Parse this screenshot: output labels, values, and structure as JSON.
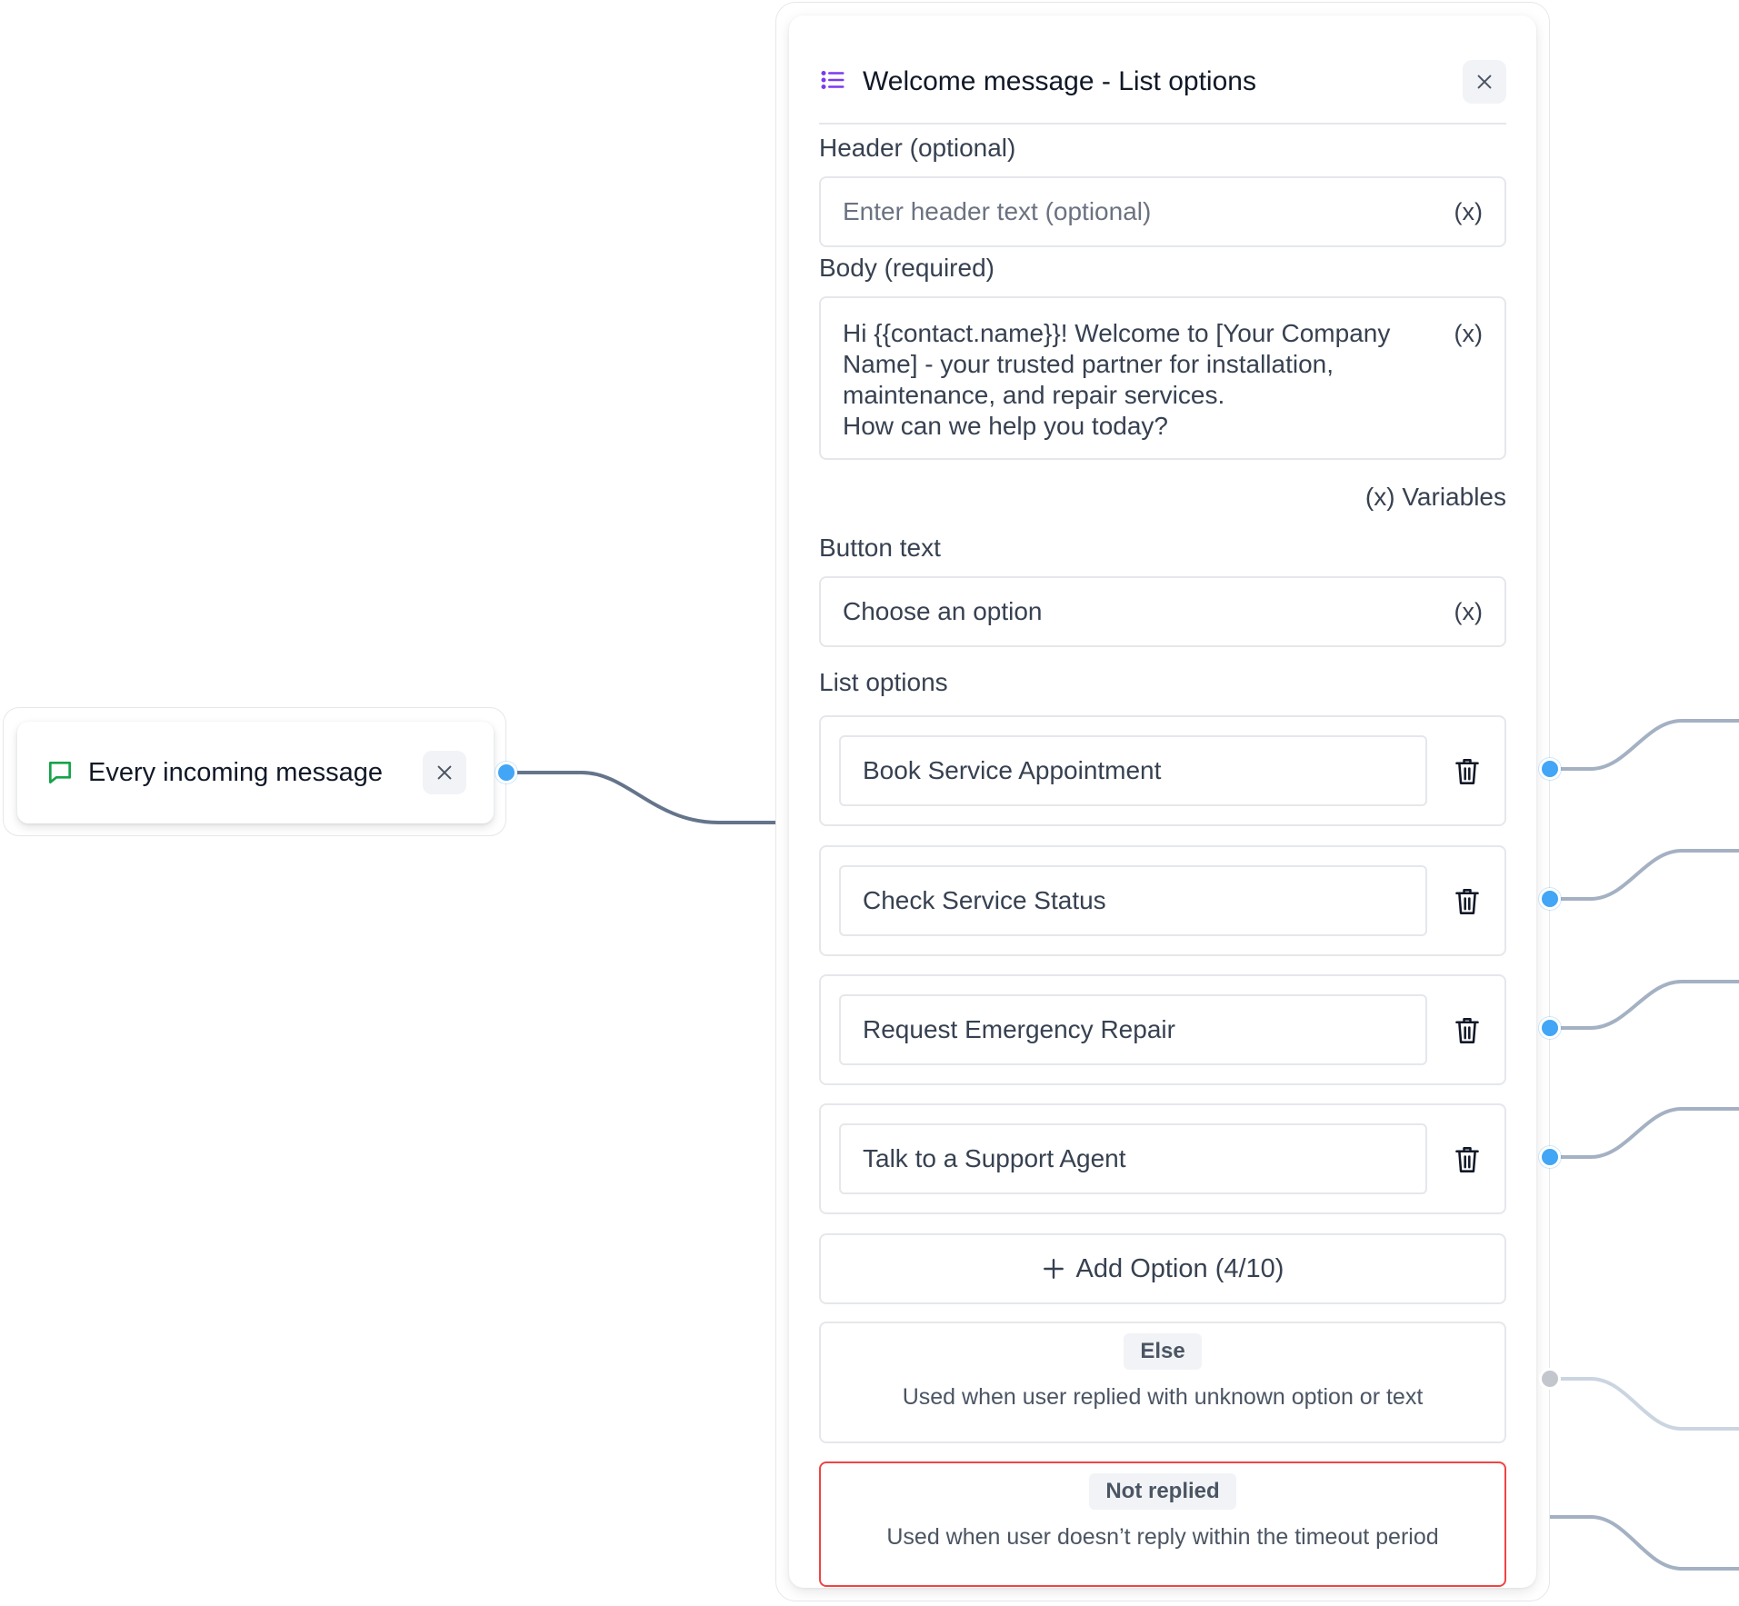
{
  "trigger": {
    "icon": "chat-bubble-icon",
    "title": "Every incoming message"
  },
  "panel": {
    "icon": "list-icon",
    "title": "Welcome message - List options",
    "header_label": "Header (optional)",
    "header_placeholder": "Enter header text (optional)",
    "body_label": "Body (required)",
    "body_lines": [
      "Hi {{contact.name}}! Welcome to [Your Company",
      "Name] - your trusted partner for installation,",
      "maintenance, and repair services.",
      "How can we help you today?"
    ],
    "variable_token": "(x)",
    "variables_link": "(x) Variables",
    "button_text_label": "Button text",
    "button_text_value": "Choose an option",
    "list_options_label": "List options",
    "options": [
      {
        "label": "Book Service Appointment"
      },
      {
        "label": "Check Service Status"
      },
      {
        "label": "Request Emergency Repair"
      },
      {
        "label": "Talk to a Support Agent"
      }
    ],
    "add_option": "Add Option (4/10)",
    "else_badge": "Else",
    "else_desc": "Used when user replied with unknown option or text",
    "not_replied_badge": "Not replied",
    "not_replied_desc": "Used when user doesn’t reply within the timeout period"
  },
  "colors": {
    "accent": "#7c3aed",
    "handle": "#42a5f5",
    "trigger_icon": "#16a34a",
    "alert_border": "#ef4444",
    "wire": "#64748b"
  }
}
